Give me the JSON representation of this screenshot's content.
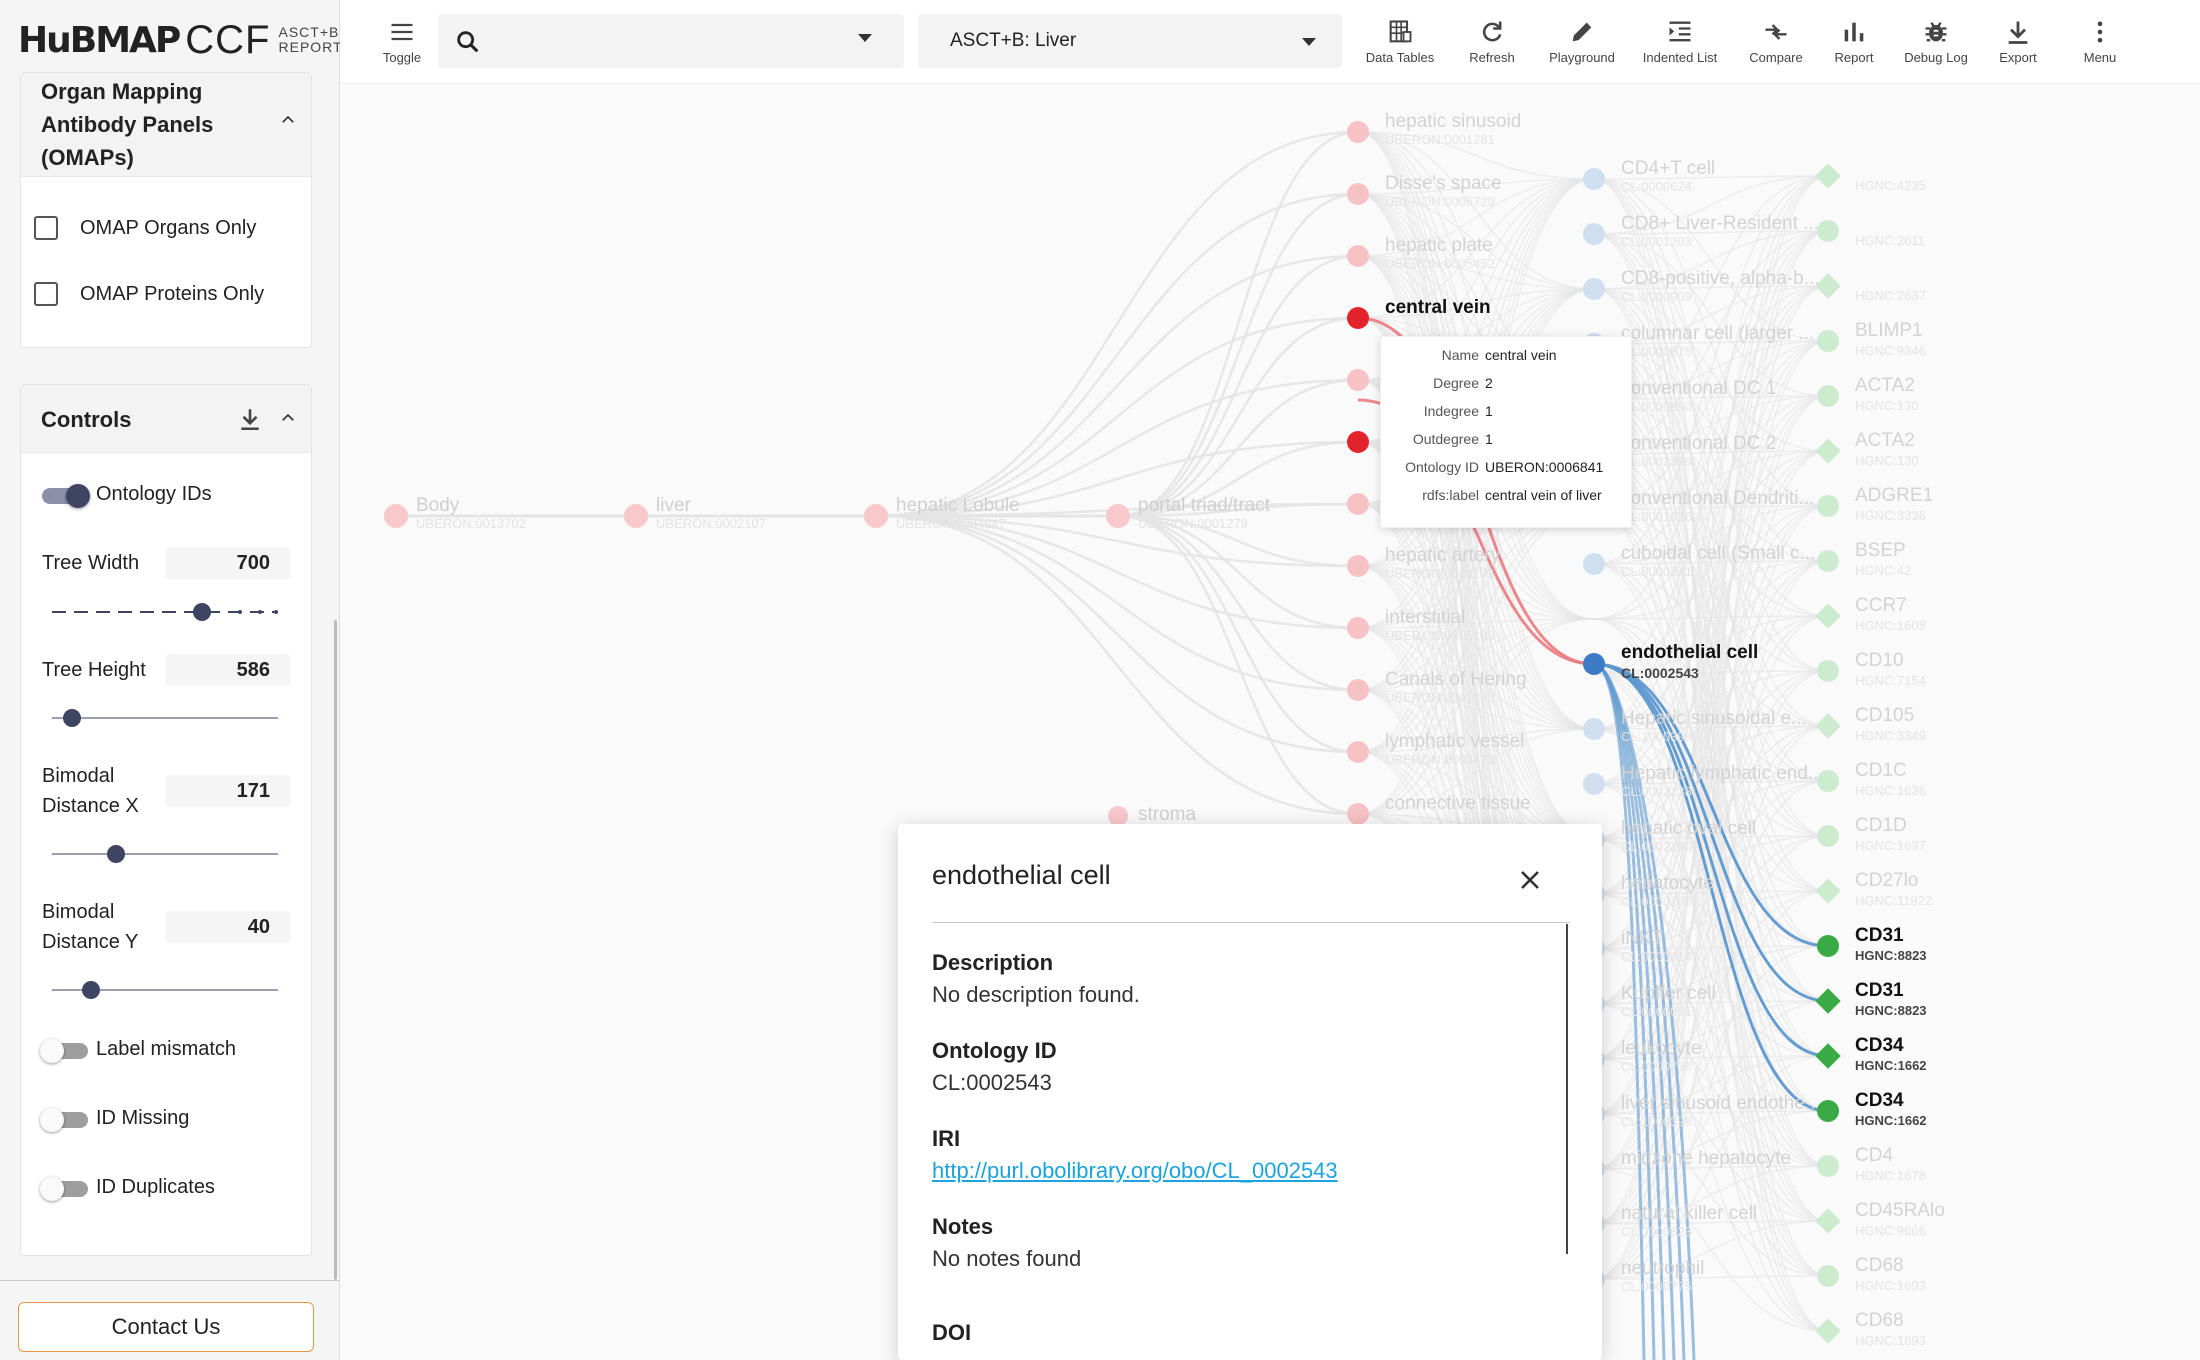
{
  "logo": {
    "hub": "HuBMAP",
    "ccf": "CCF",
    "sub1": "ASCT+B",
    "sub2": "REPORTER"
  },
  "omap_panel": {
    "title_l1": "Organ Mapping",
    "title_l2": "Antibody Panels",
    "title_l3": "(OMAPs)",
    "organs_only": "OMAP Organs Only",
    "proteins_only": "OMAP Proteins Only"
  },
  "controls": {
    "title": "Controls",
    "ontology_ids": "Ontology IDs",
    "tree_width_label": "Tree Width",
    "tree_width": "700",
    "tree_height_label": "Tree Height",
    "tree_height": "586",
    "bimodal_x_l1": "Bimodal",
    "bimodal_x_l2": "Distance X",
    "bimodal_x": "171",
    "bimodal_y_l1": "Bimodal",
    "bimodal_y_l2": "Distance Y",
    "bimodal_y": "40",
    "label_mismatch": "Label mismatch",
    "id_missing": "ID Missing",
    "id_duplicates": "ID Duplicates"
  },
  "contact": "Contact Us",
  "toolbar": {
    "toggle": "Toggle",
    "sheet": "ASCT+B: Liver",
    "data_tables": "Data Tables",
    "refresh": "Refresh",
    "playground": "Playground",
    "indented_list": "Indented List",
    "compare": "Compare",
    "report": "Report",
    "debug_log": "Debug Log",
    "export": "Export",
    "menu": "Menu"
  },
  "graph": {
    "faded_as_left": [
      {
        "name": "Body",
        "id": "UBERON:0013702"
      },
      {
        "name": "liver",
        "id": "UBERON:0002107"
      },
      {
        "name": "hepatic Lobule",
        "id": "UBERON:0004647"
      },
      {
        "name": "portal triad/tract",
        "id": "UBERON:0001279"
      }
    ],
    "as_nodes": [
      {
        "name": "hepatic sinusoid",
        "id": "UBERON:0001281"
      },
      {
        "name": "Disse's space",
        "id": "UBERON:0006729"
      },
      {
        "name": "hepatic plate",
        "id": "UBERON:0005452"
      },
      {
        "name": "central vein",
        "id": "UBERON:0006841"
      },
      {
        "name": "",
        "id": ""
      },
      {
        "name": "",
        "id": ""
      },
      {
        "name": "",
        "id": ""
      },
      {
        "name": "hepatic artery",
        "id": "UBERON:0001193"
      },
      {
        "name": "interstitial",
        "id": "UBERON:0005169"
      },
      {
        "name": "Canals of Hering",
        "id": "UBERON:0001282"
      },
      {
        "name": "lymphatic vessel",
        "id": "UBERON:0001473"
      },
      {
        "name": "connective tissue",
        "id": ""
      }
    ],
    "stroma": "stroma",
    "ct_nodes": [
      {
        "name": "CD4+T cell",
        "id": "CL:0000624"
      },
      {
        "name": "CD8+ Liver-Resident ...",
        "id": "CL:0001203"
      },
      {
        "name": "CD8-positive, alpha-b...",
        "id": "CL:0000909"
      },
      {
        "name": "columnar cell (larger ...",
        "id": "CL:0000075"
      },
      {
        "name": "conventional DC 1",
        "id": "CL:0000990"
      },
      {
        "name": "conventional DC 2",
        "id": "CL:0002399"
      },
      {
        "name": "conventional Dendriti...",
        "id": "CL:0001056"
      },
      {
        "name": "cuboidal cell (Small c...",
        "id": "CL:0000241"
      },
      {
        "name": "",
        "id": ""
      },
      {
        "name": "endothelial cell",
        "id": ""
      },
      {
        "name": "Hepatic sinusoidal e...",
        "id": "CL:1000398"
      },
      {
        "name": "Hepatic lymphatic end...",
        "id": "CL:0002138"
      },
      {
        "name": "hepatic oval cell",
        "id": "CL:0002196"
      },
      {
        "name": "hepatocyte",
        "id": "CL:0000182"
      },
      {
        "name": "iNKT",
        "id": "CL:0000814"
      },
      {
        "name": "Kupffer cell",
        "id": "CL:0000091"
      },
      {
        "name": "leukocyte",
        "id": "CL:0000738"
      },
      {
        "name": "liver sinusoid endothe...",
        "id": "CL:1000398"
      },
      {
        "name": "midzone hepatocyte",
        "id": ""
      },
      {
        "name": "natural killer cell",
        "id": "CL:0000623"
      },
      {
        "name": "neutrophil",
        "id": "CL:0000775"
      }
    ],
    "bm_nodes": [
      {
        "name": "",
        "id": "HGNC:4235",
        "shape": "diamond"
      },
      {
        "name": "",
        "id": "HGNC:2611",
        "shape": "circle"
      },
      {
        "name": "",
        "id": "HGNC:2637",
        "shape": "diamond"
      },
      {
        "name": "BLIMP1",
        "id": "HGNC:9346",
        "shape": "circle"
      },
      {
        "name": "ACTA2",
        "id": "HGNC:130",
        "shape": "circle"
      },
      {
        "name": "ACTA2",
        "id": "HGNC:130",
        "shape": "diamond"
      },
      {
        "name": "ADGRE1",
        "id": "HGNC:3336",
        "shape": "circle"
      },
      {
        "name": "BSEP",
        "id": "HGNC:42",
        "shape": "circle"
      },
      {
        "name": "CCR7",
        "id": "HGNC:1608",
        "shape": "diamond"
      },
      {
        "name": "CD10",
        "id": "HGNC:7154",
        "shape": "circle"
      },
      {
        "name": "CD105",
        "id": "HGNC:3349",
        "shape": "diamond"
      },
      {
        "name": "CD1C",
        "id": "HGNC:1636",
        "shape": "circle"
      },
      {
        "name": "CD1D",
        "id": "HGNC:1637",
        "shape": "circle"
      },
      {
        "name": "CD27lo",
        "id": "HGNC:11922",
        "shape": "diamond"
      },
      {
        "name": "CD31",
        "id": "HGNC:8823",
        "shape": "circle"
      },
      {
        "name": "CD31",
        "id": "HGNC:8823",
        "shape": "diamond"
      },
      {
        "name": "CD34",
        "id": "HGNC:1662",
        "shape": "diamond"
      },
      {
        "name": "CD34",
        "id": "HGNC:1662",
        "shape": "circle"
      },
      {
        "name": "CD4",
        "id": "HGNC:1678",
        "shape": "circle"
      },
      {
        "name": "CD45RAlo",
        "id": "HGNC:9666",
        "shape": "diamond"
      },
      {
        "name": "CD68",
        "id": "HGNC:1693",
        "shape": "circle"
      },
      {
        "name": "CD68",
        "id": "HGNC:1693",
        "shape": "diamond"
      }
    ],
    "highlight_as": {
      "name": "central vein"
    },
    "highlight_ct": {
      "name": "endothelial cell",
      "id": "CL:0002543"
    },
    "colors": {
      "as": "#e3232c",
      "ct": "#3d7cc4",
      "bm": "#3aaa45",
      "edge_red": "#ea7b80",
      "edge_blue": "#5c97cf",
      "faded_edge": "#e4e4e4"
    }
  },
  "tooltip": {
    "rows": [
      {
        "k": "Name",
        "v": "central vein"
      },
      {
        "k": "Degree",
        "v": "2"
      },
      {
        "k": "Indegree",
        "v": "1"
      },
      {
        "k": "Outdegree",
        "v": "1"
      },
      {
        "k": "Ontology ID",
        "v": "UBERON:0006841"
      },
      {
        "k": "rdfs:label",
        "v": "central vein of liver"
      }
    ]
  },
  "modal": {
    "title": "endothelial cell",
    "description_h": "Description",
    "description": "No description found.",
    "ontology_h": "Ontology ID",
    "ontology": "CL:0002543",
    "iri_h": "IRI",
    "iri": "http://purl.obolibrary.org/obo/CL_0002543",
    "notes_h": "Notes",
    "notes": "No notes found",
    "doi_h": "DOI"
  }
}
